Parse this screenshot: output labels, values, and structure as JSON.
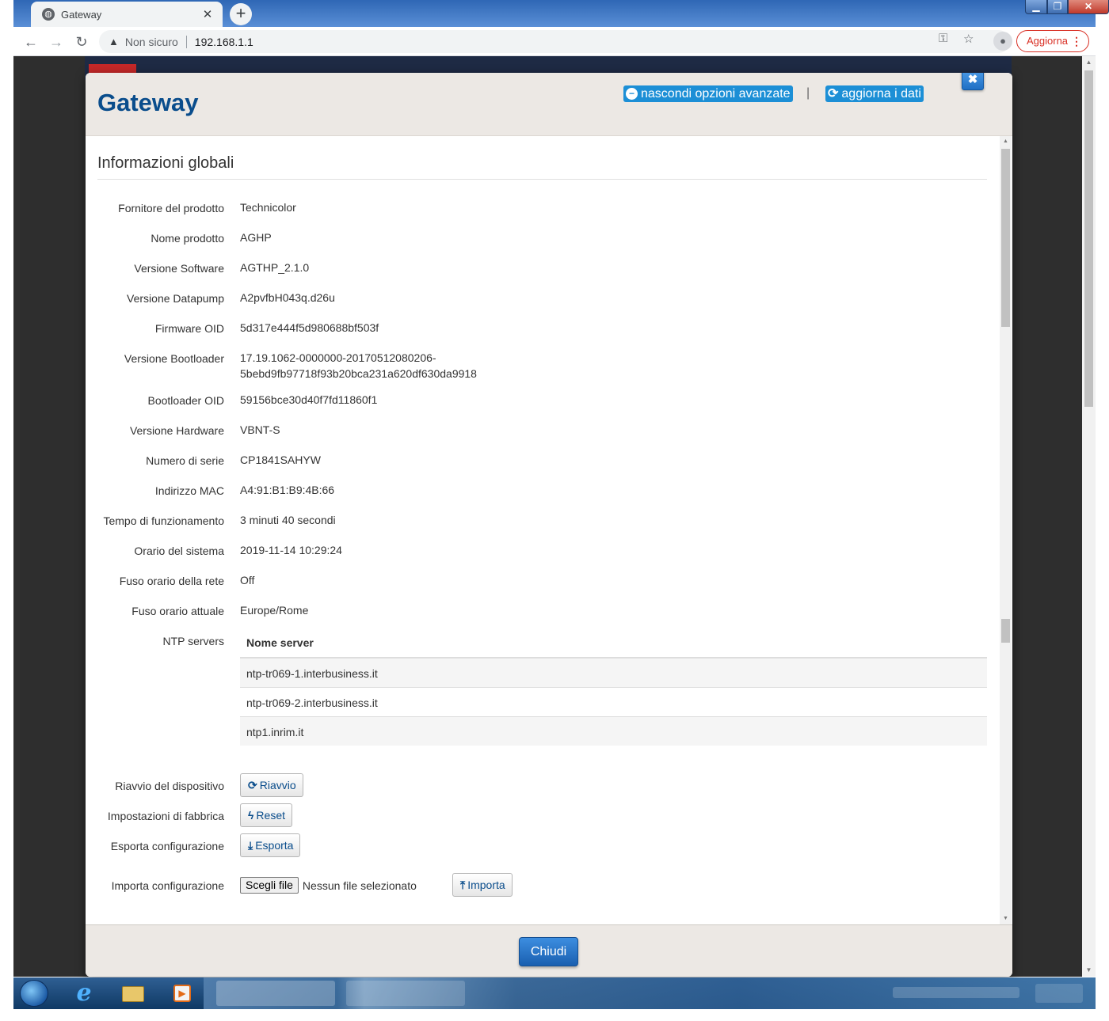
{
  "browser": {
    "tab_title": "Gateway",
    "tab_close": "✕",
    "new_tab": "+",
    "security_label": "Non sicuro",
    "url": "192.168.1.1",
    "update_label": "Aggiorna"
  },
  "modal": {
    "title": "Gateway",
    "hide_advanced_label": "nascondi opzioni avanzate",
    "separator": "|",
    "refresh_label": "aggiorna i dati",
    "close_x": "✖",
    "section_title": "Informazioni globali",
    "footer_close_label": "Chiudi"
  },
  "info": [
    {
      "label": "Fornitore del prodotto",
      "value": "Technicolor"
    },
    {
      "label": "Nome prodotto",
      "value": "AGHP"
    },
    {
      "label": "Versione Software",
      "value": "AGTHP_2.1.0"
    },
    {
      "label": "Versione Datapump",
      "value": "A2pvfbH043q.d26u"
    },
    {
      "label": "Firmware OID",
      "value": "5d317e444f5d980688bf503f"
    },
    {
      "label": "Versione Bootloader",
      "value": "17.19.1062-0000000-20170512080206-",
      "value2": "5bebd9fb97718f93b20bca231a620df630da9918"
    },
    {
      "label": "Bootloader OID",
      "value": "59156bce30d40f7fd11860f1"
    },
    {
      "label": "Versione Hardware",
      "value": "VBNT-S"
    },
    {
      "label": "Numero di serie",
      "value": "CP1841SAHYW"
    },
    {
      "label": "Indirizzo MAC",
      "value": "A4:91:B1:B9:4B:66"
    },
    {
      "label": "Tempo di funzionamento",
      "value": "3 minuti 40 secondi"
    },
    {
      "label": "Orario del sistema",
      "value": "2019-11-14 10:29:24"
    },
    {
      "label": "Fuso orario della rete",
      "value": "Off"
    },
    {
      "label": "Fuso orario attuale",
      "value": "Europe/Rome"
    }
  ],
  "ntp": {
    "label": "NTP servers",
    "column_header": "Nome server",
    "servers": [
      "ntp-tr069-1.interbusiness.it",
      "ntp-tr069-2.interbusiness.it",
      "ntp1.inrim.it"
    ]
  },
  "actions": {
    "reboot": {
      "label": "Riavvio del dispositivo",
      "button": "Riavvio"
    },
    "factory": {
      "label": "Impostazioni di fabbrica",
      "button": "Reset"
    },
    "export": {
      "label": "Esporta configurazione",
      "button": "Esporta"
    },
    "import": {
      "label": "Importa configurazione",
      "choose_file": "Scegli file",
      "file_status": "Nessun file selezionato",
      "button": "Importa"
    }
  },
  "colors": {
    "title_blue": "#0a4d8c",
    "header_button_blue": "#1c8fd6",
    "modal_header_bg": "#ece8e4",
    "security_warning_red": "#d93025"
  },
  "icons": {
    "hide_advanced": "minus-circle-icon",
    "refresh": "refresh-icon",
    "reboot": "refresh-icon",
    "reset": "bolt-icon",
    "export": "download-icon",
    "import": "upload-icon"
  }
}
